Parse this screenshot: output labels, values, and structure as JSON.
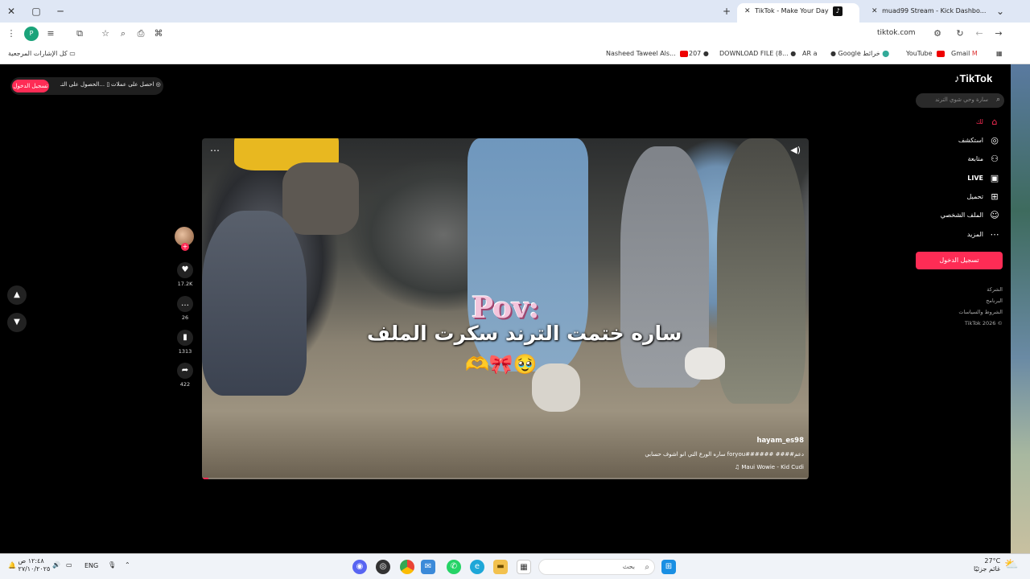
{
  "browser": {
    "tabs": [
      {
        "title": "TikTok - Make Your Day",
        "active": true
      },
      {
        "title": "muad99 Stream - Kick Dashbo...",
        "active": false
      }
    ],
    "url": "tiktok.com",
    "bookmarks_all": "كل الإشارات المرجعية",
    "bookmarks": [
      "Nasheed Taweel Als...",
      "207",
      "DOWNLOAD FILE (8...",
      "AR",
      "Google خرائط",
      "YouTube",
      "Gmail"
    ]
  },
  "tiktok": {
    "logo": "TikTok",
    "search_placeholder": "سارة وحي شوي الترند",
    "top": {
      "signup": "تسجيل الدخول",
      "get_app": "الحصول على التـ...",
      "get_coins": "احصل على عملات"
    },
    "nav": [
      {
        "label": "لك",
        "icon": "home-icon",
        "active": true
      },
      {
        "label": "استكشف",
        "icon": "compass-icon",
        "active": false
      },
      {
        "label": "متابعة",
        "icon": "following-icon",
        "active": false
      },
      {
        "label": "LIVE",
        "icon": "live-icon",
        "active": false
      },
      {
        "label": "تحميل",
        "icon": "upload-icon",
        "active": false
      },
      {
        "label": "الملف الشخصي",
        "icon": "profile-icon",
        "active": false
      },
      {
        "label": "المزيد",
        "icon": "more-icon",
        "active": false
      }
    ],
    "login_button": "تسجيل الدخول",
    "footer": [
      "الشركة",
      "البرنامج",
      "الشروط والسياسات",
      "TikTok 2026 ©"
    ],
    "video": {
      "overlay_title": "Pov:",
      "overlay_text": "ساره ختمت الترند سكرت الملف",
      "overlay_emoji": "🫶🎀🥹",
      "author": "hayam_es98",
      "description": "ساره الورع التي انو اشوف حسابي foryou###### ####دعم",
      "music": "♫ Maui Wowie - Kid Cudi",
      "progress": 0.01
    },
    "actions": {
      "likes": "17.2K",
      "comments": "26",
      "saves": "1313",
      "shares": "422"
    }
  },
  "taskbar": {
    "search_placeholder": "بحث",
    "weather_temp": "27°C",
    "weather_text": "غائم جزئيًا",
    "lang": "ENG",
    "time": "١٢:٤٨ ص",
    "date": "٢٧/١٠/٢٠٢٥"
  }
}
